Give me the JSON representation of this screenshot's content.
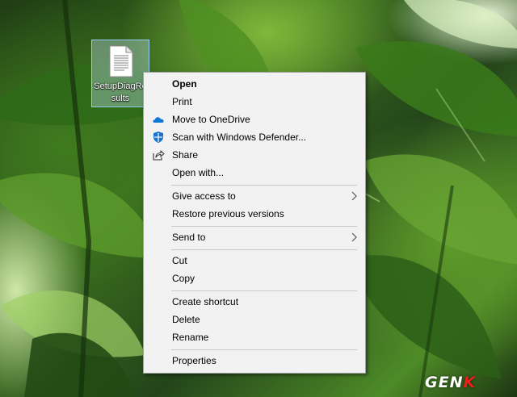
{
  "desktop": {
    "file_icon": {
      "name": "SetupDiagResults",
      "icon": "text-document-icon"
    }
  },
  "context_menu": {
    "items": [
      {
        "label": "Open",
        "bold": true
      },
      {
        "label": "Print"
      },
      {
        "label": "Move to OneDrive",
        "icon": "onedrive-cloud-icon"
      },
      {
        "label": "Scan with Windows Defender...",
        "icon": "windows-defender-shield-icon"
      },
      {
        "label": "Share",
        "icon": "share-icon"
      },
      {
        "label": "Open with..."
      },
      {
        "label": "Give access to",
        "submenu": true
      },
      {
        "label": "Restore previous versions"
      },
      {
        "label": "Send to",
        "submenu": true
      },
      {
        "label": "Cut"
      },
      {
        "label": "Copy"
      },
      {
        "label": "Create shortcut"
      },
      {
        "label": "Delete"
      },
      {
        "label": "Rename"
      },
      {
        "label": "Properties"
      }
    ]
  },
  "watermark": {
    "text_main": "GEN",
    "text_accent": "K"
  },
  "colors": {
    "menu_bg": "#f2f2f2",
    "onedrive_blue": "#0f78d4",
    "defender_blue": "#1a73c8",
    "watermark_red": "#e8211b"
  }
}
